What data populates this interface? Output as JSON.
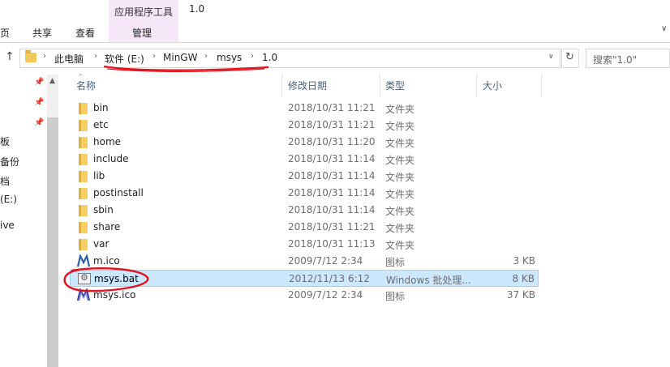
{
  "title": "1.0",
  "ribbon": {
    "contextual_tab": "应用程序工具",
    "tabs": [
      "页",
      "共享",
      "查看",
      "管理"
    ]
  },
  "address": {
    "crumbs": [
      "此电脑",
      "软件 (E:)",
      "MinGW",
      "msys",
      "1.0"
    ]
  },
  "search": {
    "placeholder": "搜索\"1.0\""
  },
  "nav": {
    "items": [
      "板",
      "备份",
      "档",
      "(E:)",
      "ive"
    ]
  },
  "columns": {
    "name": "名称",
    "date": "修改日期",
    "type": "类型",
    "size": "大小"
  },
  "files": [
    {
      "name": "bin",
      "date": "2018/10/31 11:21",
      "type": "文件夹",
      "size": "",
      "icon": "folder-icon"
    },
    {
      "name": "etc",
      "date": "2018/10/31 11:21",
      "type": "文件夹",
      "size": "",
      "icon": "folder-icon"
    },
    {
      "name": "home",
      "date": "2018/10/31 11:20",
      "type": "文件夹",
      "size": "",
      "icon": "folder-icon"
    },
    {
      "name": "include",
      "date": "2018/10/31 11:14",
      "type": "文件夹",
      "size": "",
      "icon": "folder-icon"
    },
    {
      "name": "lib",
      "date": "2018/10/31 11:14",
      "type": "文件夹",
      "size": "",
      "icon": "folder-icon"
    },
    {
      "name": "postinstall",
      "date": "2018/10/31 11:14",
      "type": "文件夹",
      "size": "",
      "icon": "folder-icon"
    },
    {
      "name": "sbin",
      "date": "2018/10/31 11:14",
      "type": "文件夹",
      "size": "",
      "icon": "folder-icon"
    },
    {
      "name": "share",
      "date": "2018/10/31 11:21",
      "type": "文件夹",
      "size": "",
      "icon": "folder-icon"
    },
    {
      "name": "var",
      "date": "2018/10/31 11:13",
      "type": "文件夹",
      "size": "",
      "icon": "folder-icon"
    },
    {
      "name": "m.ico",
      "date": "2009/7/12 2:34",
      "type": "图标",
      "size": "3 KB",
      "icon": "mingw-ico-icon"
    },
    {
      "name": "msys.bat",
      "date": "2012/11/13 6:12",
      "type": "Windows 批处理...",
      "size": "8 KB",
      "icon": "batch-file-icon",
      "selected": true
    },
    {
      "name": "msys.ico",
      "date": "2009/7/12 2:34",
      "type": "图标",
      "size": "37 KB",
      "icon": "msys-ico-icon"
    }
  ],
  "annotation_color": "#e0141e",
  "selection_color": "#cce8ff"
}
